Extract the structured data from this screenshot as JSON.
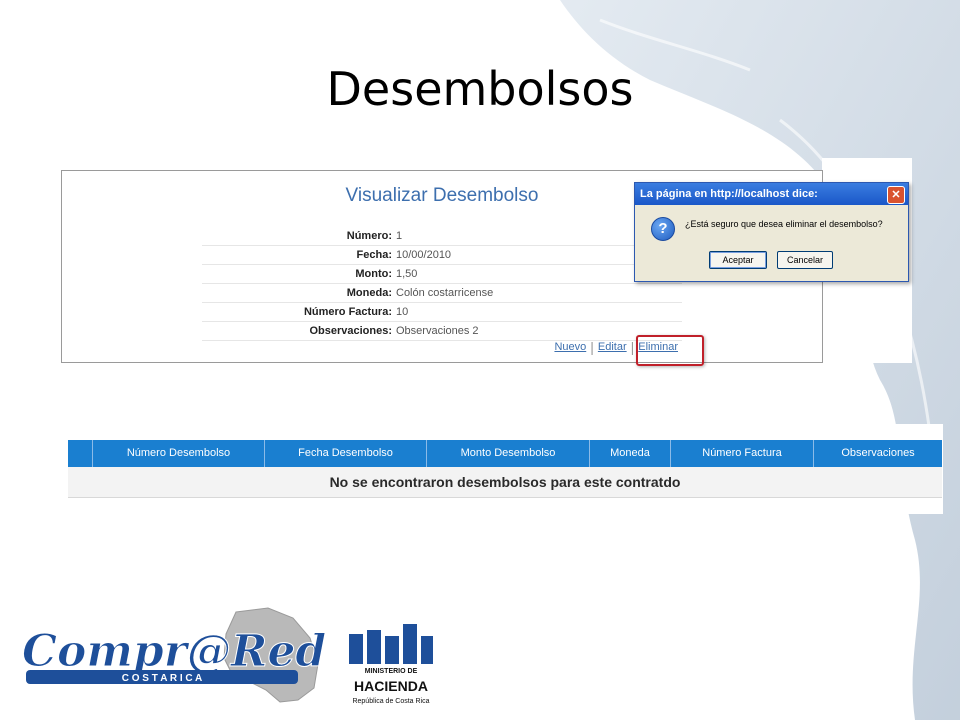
{
  "slide": {
    "title": "Desembolsos"
  },
  "view": {
    "title": "Visualizar Desembolso",
    "fields": [
      {
        "label": "Número:",
        "value": "1"
      },
      {
        "label": "Fecha:",
        "value": "10/00/2010"
      },
      {
        "label": "Monto:",
        "value": "1,50"
      },
      {
        "label": "Moneda:",
        "value": "Colón costarricense"
      },
      {
        "label": "Número Factura:",
        "value": "10"
      },
      {
        "label": "Observaciones:",
        "value": "Observaciones 2"
      }
    ],
    "actions": {
      "nuevo": "Nuevo",
      "editar": "Editar",
      "eliminar": "Eliminar"
    }
  },
  "dialog": {
    "title": "La página en http://localhost dice:",
    "message": "¿Está seguro que desea eliminar el desembolso?",
    "ok": "Aceptar",
    "cancel": "Cancelar",
    "icon": "question-icon"
  },
  "table": {
    "headers": [
      "Número Desembolso",
      "Fecha Desembolso",
      "Monto Desembolso",
      "Moneda",
      "Número Factura",
      "Observaciones"
    ],
    "empty_message": "No se encontraron desembolsos para este contratdo",
    "header_color": "#1a7fd0"
  },
  "logos": {
    "compra": {
      "main": "Compr@Red",
      "sub": "C O S T A R I C A"
    },
    "hacienda": {
      "line1": "MINISTERIO DE",
      "line2": "HACIENDA",
      "line3": "República de Costa Rica"
    }
  },
  "colors": {
    "link": "#3d6fae",
    "dialog_title": "#1a57c8",
    "highlight": "#c0202a"
  }
}
